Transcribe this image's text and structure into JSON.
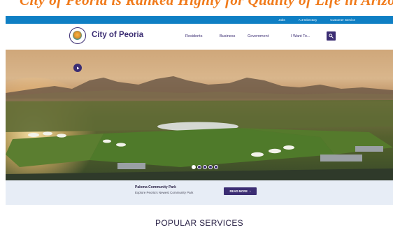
{
  "top_banner": {
    "text": "City of Peoria is Ranked Highly for Quality of Life in Arizona"
  },
  "utility_nav": [
    "Jobs",
    "A-Z Directory",
    "Customer Service"
  ],
  "logo": {
    "name": "City of Peoria"
  },
  "main_nav": [
    "Residents",
    "Business",
    "Government",
    "I Want To..."
  ],
  "search": {
    "icon": "search-icon"
  },
  "hero": {
    "slide_count": 5,
    "active_slide": 1,
    "caption_title": "Paloma Community Park",
    "caption_subtitle": "Explore Peoria's Newest Community Park",
    "cta_label": "READ MORE"
  },
  "section": {
    "title": "POPULAR SERVICES"
  },
  "colors": {
    "brand": "#3b2d73",
    "utility": "#0f7fc4",
    "accent": "#f07a1a",
    "caption_bg": "#e7edf6"
  }
}
